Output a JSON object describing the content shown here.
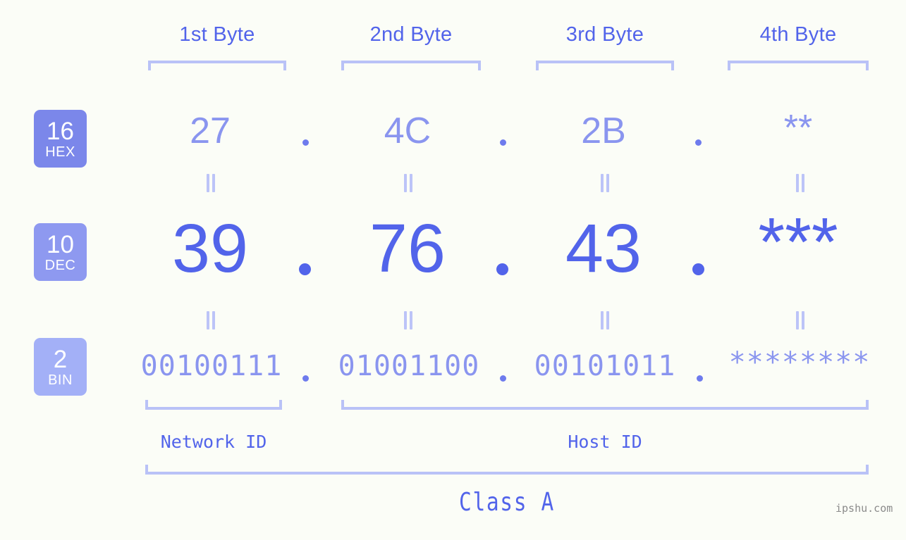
{
  "background_color": "#fbfdf7",
  "accent_strong": "#5264ea",
  "accent_mid": "#8a95ef",
  "accent_light": "#b9c2f7",
  "byte_headers": [
    {
      "label": "1st Byte"
    },
    {
      "label": "2nd Byte"
    },
    {
      "label": "3rd Byte"
    },
    {
      "label": "4th Byte"
    }
  ],
  "bases": [
    {
      "number": "16",
      "name": "HEX",
      "color": "#7b87ea"
    },
    {
      "number": "10",
      "name": "DEC",
      "color": "#8e99f0"
    },
    {
      "number": "2",
      "name": "BIN",
      "color": "#a3b0f7"
    }
  ],
  "rows": {
    "hex": {
      "values": [
        "27",
        "4C",
        "2B",
        "**"
      ]
    },
    "dec": {
      "values": [
        "39",
        "76",
        "43",
        "***"
      ]
    },
    "bin": {
      "values": [
        "00100111",
        "01001100",
        "00101011",
        "********"
      ]
    }
  },
  "separator_dot": ".",
  "equality_mark": "||",
  "segments": [
    {
      "label": "Network ID"
    },
    {
      "label": "Host ID"
    }
  ],
  "class_label": "Class A",
  "watermark": "ipshu.com"
}
